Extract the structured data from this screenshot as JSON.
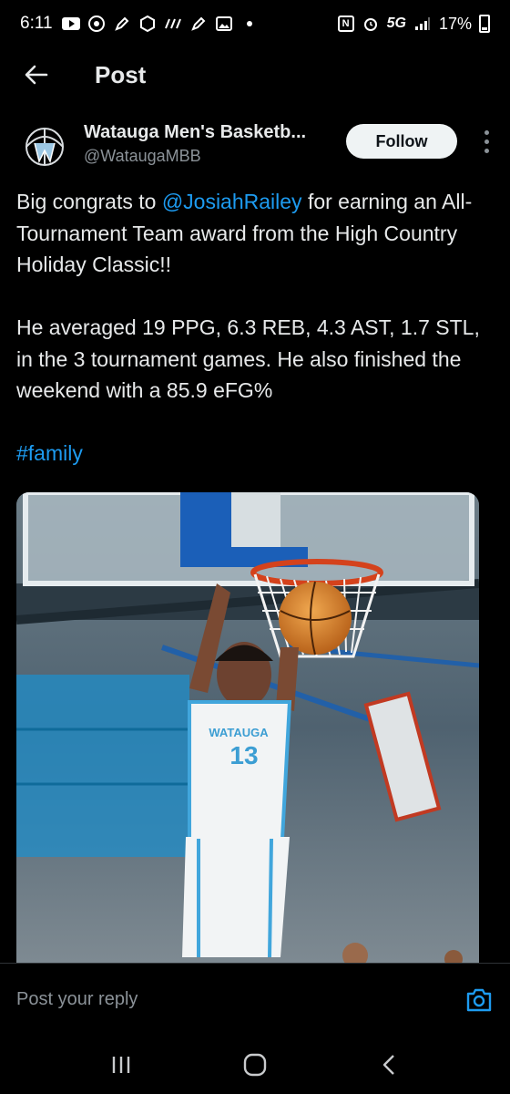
{
  "status_bar": {
    "time": "6:11",
    "network": "5G",
    "battery": "17%"
  },
  "header": {
    "title": "Post"
  },
  "author": {
    "name": "Watauga Men's Basketb...",
    "handle": "@WataugaMBB",
    "follow_label": "Follow"
  },
  "post": {
    "line1_pre": "Big congrats to ",
    "mention": "@JosiahRailey",
    "line1_post": " for  earning an All-Tournament Team award from the High Country Holiday Classic!!",
    "paragraph2": "He averaged 19 PPG, 6.3 REB, 4.3 AST, 1.7 STL, in the 3 tournament games. He also finished the weekend with a 85.9 eFG%",
    "hashtag": "#family"
  },
  "image": {
    "jersey_number": "13",
    "jersey_text": "WATAUGA"
  },
  "reply": {
    "placeholder": "Post your reply"
  },
  "colors": {
    "accent": "#1d9bf0",
    "background": "#000000",
    "text": "#e7e9ea",
    "muted": "#8b9298"
  }
}
